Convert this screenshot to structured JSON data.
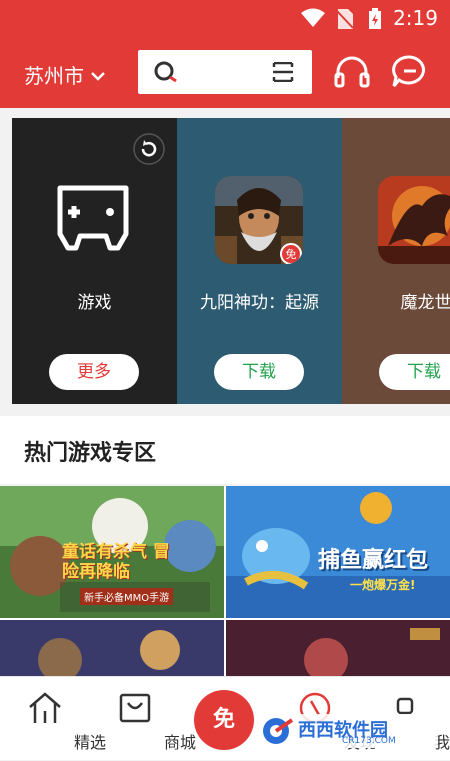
{
  "status": {
    "time": "2:19"
  },
  "header": {
    "city": "苏州市"
  },
  "carousel": {
    "cards": [
      {
        "title": "游戏",
        "button": "更多"
      },
      {
        "title": "九阳神功：起源",
        "button": "下载",
        "badge": "免"
      },
      {
        "title": "魔龙世界",
        "button": "下载"
      }
    ]
  },
  "section": {
    "title": "热门游戏专区"
  },
  "banners": [
    {
      "caption": "童话有杀气 冒险再降临",
      "tagline": "新手必备MMO手游"
    },
    {
      "caption": "捕鱼赢红包",
      "tagline": "一炮爆万金!"
    }
  ],
  "nav": {
    "items": [
      {
        "label": "精选"
      },
      {
        "label": "商城"
      },
      {
        "label": "免"
      },
      {
        "label": "发现"
      },
      {
        "label": "我的"
      }
    ]
  },
  "watermark": {
    "text": "西西软件园",
    "sub": "CR173.COM"
  },
  "colors": {
    "brand": "#e23b37",
    "download_text": "#23a24d",
    "more_text": "#e23b37"
  }
}
